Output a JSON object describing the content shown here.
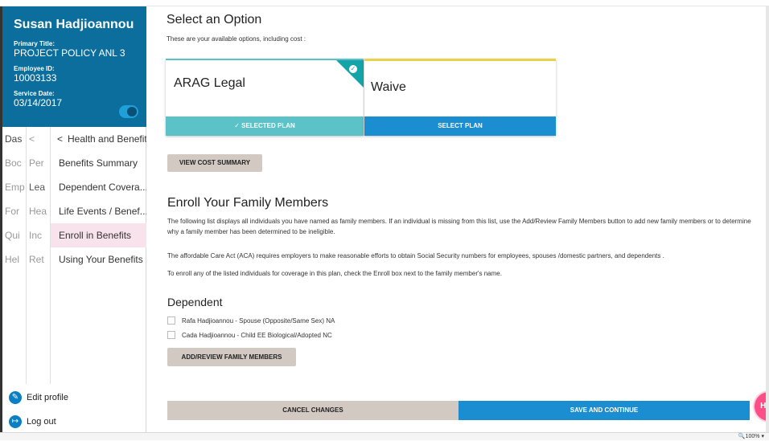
{
  "profile": {
    "name": "Susan Hadjioannou",
    "title_label": "Primary Title:",
    "title_value": "PROJECT POLICY ANL 3",
    "emp_label": "Employee ID:",
    "emp_value": "10003133",
    "service_label": "Service Date:",
    "service_value": "03/14/2017"
  },
  "nav": {
    "col1": [
      "Das",
      "Boc",
      "Emp",
      "For",
      "Qui",
      "Hel"
    ],
    "col2": [
      "<",
      "Per",
      "Lea",
      "Hea",
      "Inc",
      "Ret"
    ],
    "back": "<",
    "header": "Health and Benefits",
    "items": [
      "Benefits Summary",
      "Dependent Covera...",
      "Life Events / Benef...",
      "Enroll in Benefits",
      "Using Your Benefits"
    ]
  },
  "bottom": {
    "edit": "Edit profile",
    "logout": "Log out"
  },
  "main": {
    "heading": "Select an Option",
    "subheading": "These are your available options, including cost :",
    "card1": {
      "title": "ARAG Legal",
      "bar": "SELECTED PLAN"
    },
    "card2": {
      "title": "Waive",
      "bar": "SELECT PLAN"
    },
    "cost_button": "VIEW COST SUMMARY",
    "enroll_heading": "Enroll Your Family Members",
    "para1": "The following list displays all individuals you have named as family members. If an individual is missing from this list, use the Add/Review Family Members button to add new family members or to determine why a family member has been determined to be ineligible.",
    "para2": "The affordable Care Act (ACA) requires employers to make reasonable efforts to obtain Social Security numbers for employees, spouses /domestic partners, and dependents .",
    "para3": "To enroll any of the listed individuals for coverage in this plan, check the Enroll box next to the family member's name.",
    "dependent_heading": "Dependent",
    "dependents": [
      "Rafa Hadjioannou - Spouse (Opposite/Same Sex) NA",
      "Cada Hadjioannou - Child EE Biological/Adopted NC"
    ],
    "add_button": "ADD/REVIEW FAMILY MEMBERS",
    "cancel": "CANCEL CHANGES",
    "save": "SAVE AND CONTINUE",
    "help": "Help"
  },
  "status": {
    "zoom": "100%"
  },
  "colors": {
    "profile_bg": "#0b6e9c",
    "selected_bar": "#5bc2c8",
    "select_bar": "#1a8ed1",
    "help": "#ff4d88"
  }
}
